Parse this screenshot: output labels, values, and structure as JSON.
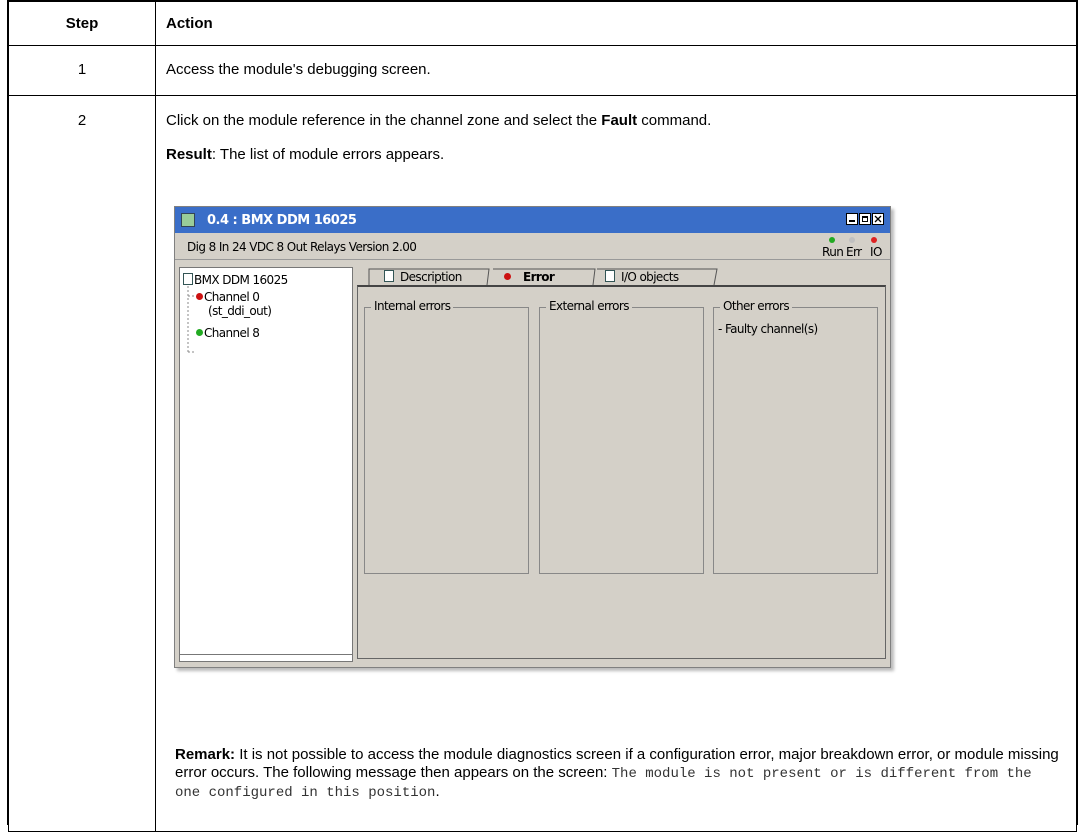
{
  "table": {
    "headers": {
      "step": "Step",
      "action": "Action"
    },
    "rows": [
      {
        "step": "1",
        "action": "Access the module's debugging screen."
      },
      {
        "step": "2",
        "action_pre": "Click on the module reference in the channel zone and select the ",
        "action_bold": "Fault",
        "action_post": " command.",
        "result_label": "Result",
        "result_text": ": The list of module errors appears.",
        "remark_label": "Remark:",
        "remark_text": " It is not possible to access the module diagnostics screen if a configuration error, major breakdown error, or module missing error occurs. The following message then appears on the screen: ",
        "remark_mono": "The module is not present or is different from the one configured in this position",
        "remark_end": "."
      }
    ]
  },
  "window": {
    "title": "0.4 : BMX DDM 16025",
    "description": "Dig 8 In 24 VDC 8 Out Relays Version 2.00",
    "leds": [
      {
        "label": "Run",
        "color": "#22aa22"
      },
      {
        "label": "Err",
        "color": "#c0c0c0"
      },
      {
        "label": "IO",
        "color": "#dd2222"
      }
    ],
    "tree": {
      "root": "BMX DDM 16025",
      "channel0": "Channel 0",
      "channel0_sub": "(st_ddi_out)",
      "channel8": "Channel 8"
    },
    "tabs": [
      "Description",
      "Error",
      "I/O objects"
    ],
    "groups": [
      {
        "title": "Internal errors",
        "content": ""
      },
      {
        "title": "External errors",
        "content": ""
      },
      {
        "title": "Other errors",
        "content": "- Faulty channel(s)"
      }
    ]
  }
}
